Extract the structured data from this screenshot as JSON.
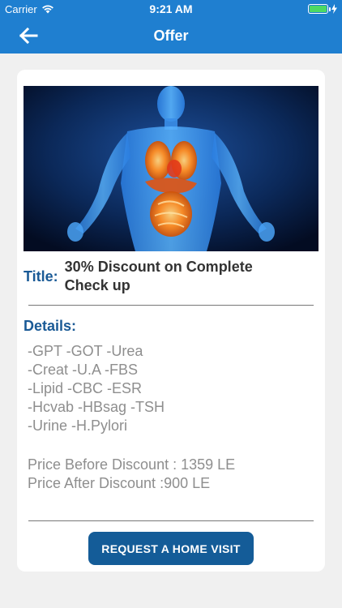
{
  "status_bar": {
    "carrier": "Carrier",
    "time": "9:21 AM",
    "battery_level": 1.0
  },
  "nav": {
    "title": "Offer",
    "back_icon": "arrow-left-icon"
  },
  "offer": {
    "title_label": "Title:",
    "title_line1": "30% Discount on Complete",
    "title_line2": "Check up",
    "details_label": "Details:",
    "tests": [
      "-GPT -GOT -Urea",
      "-Creat -U.A -FBS",
      "-Lipid -CBC -ESR",
      "-Hcvab -HBsag -TSH",
      "-Urine -H.Pylori"
    ],
    "price_before": "Price Before Discount : 1359 LE",
    "price_after": "Price After Discount :900 LE",
    "cta_label": "REQUEST A HOME VISIT"
  },
  "colors": {
    "header": "#1f7fd0",
    "accent_label": "#1a5a96",
    "cta": "#145c98",
    "muted_text": "#8e8e8e"
  }
}
